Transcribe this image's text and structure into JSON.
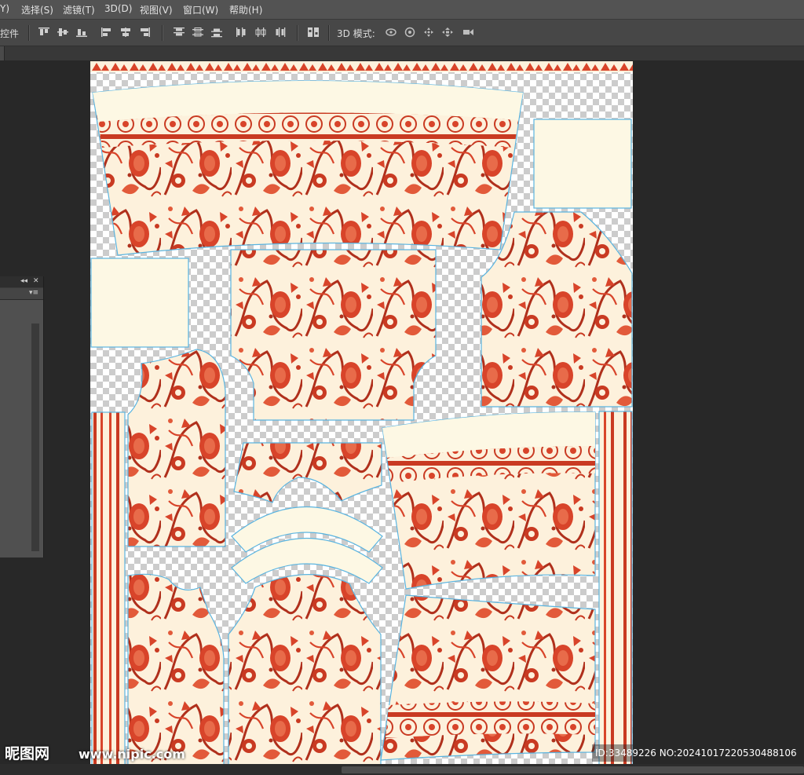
{
  "menu": [
    "Y)",
    "选择(S)",
    "滤镜(T)",
    "3D(D)",
    "视图(V)",
    "窗口(W)",
    "帮助(H)"
  ],
  "options_bar": {
    "left_label": "控件",
    "mode_label": "3D 模式:",
    "align_icons": [
      "align-top-icon",
      "align-vcenter-icon",
      "align-bottom-icon",
      "align-left-icon",
      "align-hcenter-icon",
      "align-right-icon"
    ],
    "distribute_icons": [
      "distribute-top-icon",
      "distribute-vcenter-icon",
      "distribute-bottom-icon",
      "distribute-left-icon",
      "distribute-hcenter-icon",
      "distribute-right-icon",
      "auto-align-icon"
    ],
    "mode_icons": [
      "rotate-3d-icon",
      "roll-3d-icon",
      "drag-3d-icon",
      "slide-3d-icon",
      "scale-3d-icon"
    ]
  },
  "panel": {
    "collapse": "◂◂",
    "close": "✕",
    "menu": "▾≡"
  },
  "watermark": {
    "logo": "昵图网",
    "url": "www.nipic.com",
    "id_text": "ID:33489226 NO:20241017220530488106"
  },
  "colors": {
    "fabric": "#fdf8e4",
    "print_red": "#d8442a",
    "print_dark": "#b0301c",
    "outline": "#5ab4e0",
    "canvas_check_a": "#ffffff",
    "canvas_check_b": "#cccccc"
  }
}
